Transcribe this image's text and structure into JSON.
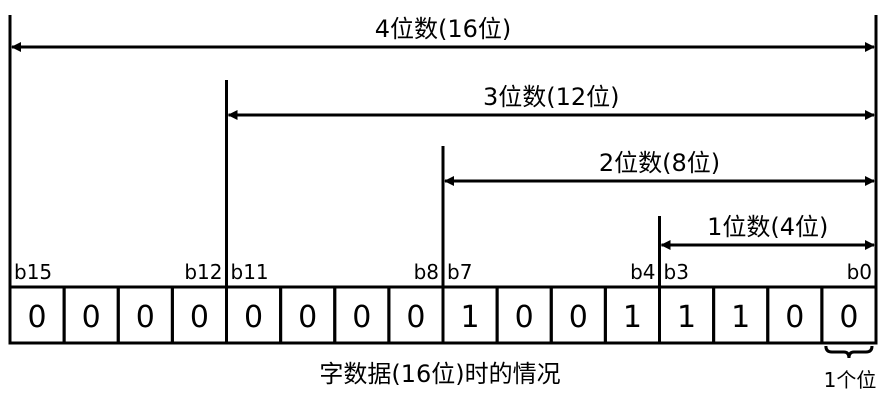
{
  "spans": [
    {
      "label": "4位数(16位)",
      "bits": 16
    },
    {
      "label": "3位数(12位)",
      "bits": 12
    },
    {
      "label": "2位数(8位)",
      "bits": 8
    },
    {
      "label": "1位数(4位)",
      "bits": 4
    }
  ],
  "bit_labels": [
    {
      "text": "b15",
      "bit": 15,
      "side": "left"
    },
    {
      "text": "b12",
      "bit": 12,
      "side": "right"
    },
    {
      "text": "b11",
      "bit": 11,
      "side": "left"
    },
    {
      "text": "b8",
      "bit": 8,
      "side": "right"
    },
    {
      "text": "b7",
      "bit": 7,
      "side": "left"
    },
    {
      "text": "b4",
      "bit": 4,
      "side": "right"
    },
    {
      "text": "b3",
      "bit": 3,
      "side": "left"
    },
    {
      "text": "b0",
      "bit": 0,
      "side": "right"
    }
  ],
  "bits": [
    "0",
    "0",
    "0",
    "0",
    "0",
    "0",
    "0",
    "0",
    "1",
    "0",
    "0",
    "1",
    "1",
    "1",
    "0",
    "0"
  ],
  "caption": "字数据(16位)时的情况",
  "unit_label": "1个位"
}
